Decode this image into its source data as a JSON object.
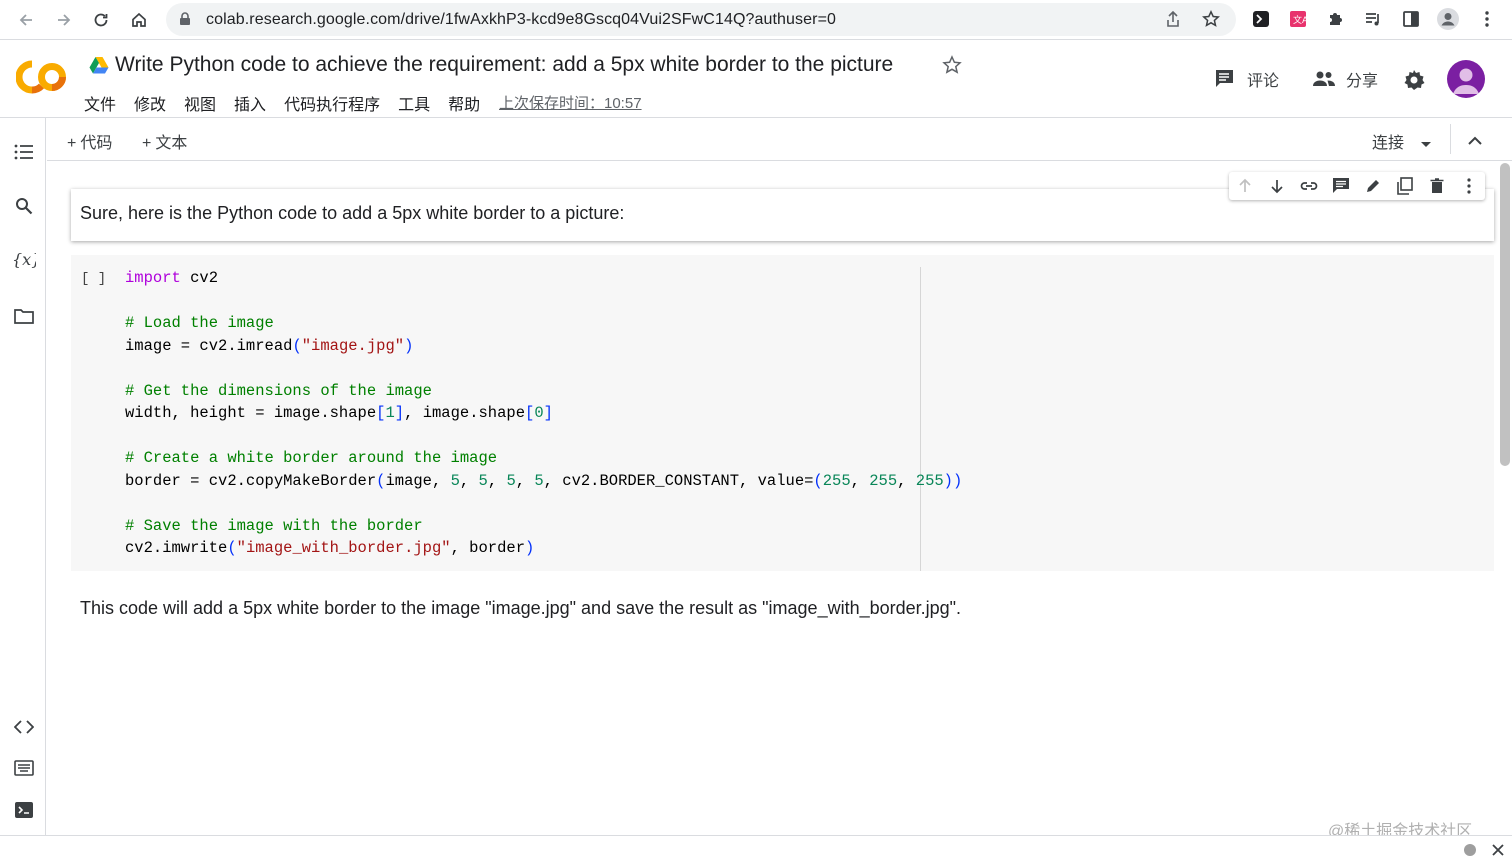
{
  "browser": {
    "url": "colab.research.google.com/drive/1fwAxkhP3-kcd9e8Gscq04Vui2SFwC14Q?authuser=0"
  },
  "header": {
    "title": "Write Python code to achieve the requirement: add a 5px white border to the picture",
    "menu": [
      "文件",
      "修改",
      "视图",
      "插入",
      "代码执行程序",
      "工具",
      "帮助"
    ],
    "save_time": "上次保存时间：10:57",
    "comment_label": "评论",
    "share_label": "分享"
  },
  "toolbar": {
    "add_code": "代码",
    "add_text": "文本",
    "connect": "连接"
  },
  "cells": {
    "text_cell": "Sure, here is the Python code to add a 5px white border to a picture:",
    "run_button": "[ ]",
    "output_text": "This code will add a 5px white border to the image \"image.jpg\" and save the result as \"image_with_border.jpg\"."
  },
  "watermark": "@稀土掘金技术社区",
  "colors": {
    "keyword": "#af00db",
    "comment": "#008000",
    "string": "#a31515",
    "number": "#098658",
    "avatar": "#7b1fa2"
  }
}
